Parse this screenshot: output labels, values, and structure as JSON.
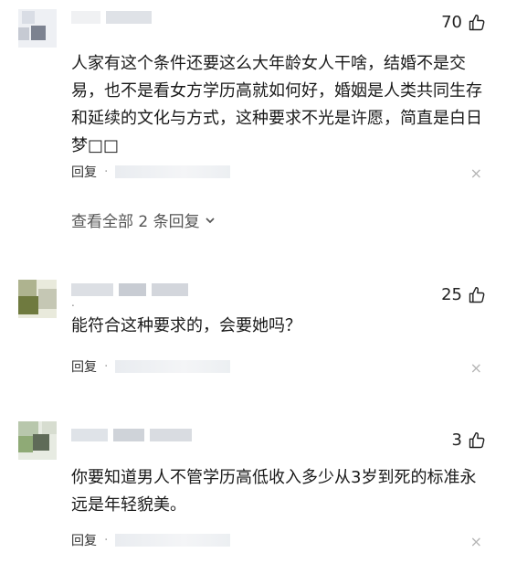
{
  "comments": [
    {
      "likes": "70",
      "text": "人家有这个条件还要这么大年龄女人干啥，结婚不是交易，也不是看女方学历高就如何好，婚姻是人类共同生存和延续的文化与方式，这种要求不光是许愿，简直是白日梦□□",
      "reply_label": "回复",
      "separator": "·",
      "close": "×",
      "view_replies": "查看全部 2 条回复"
    },
    {
      "likes": "25",
      "text": "能符合这种要求的，会要她吗？",
      "reply_label": "回复",
      "separator": "·",
      "close": "×"
    },
    {
      "likes": "3",
      "text": "你要知道男人不管学历高低收入多少从3岁到死的标准永远是年轻貌美。",
      "reply_label": "回复",
      "separator": "·",
      "close": "×"
    }
  ],
  "icons": {
    "like": "thumbs-up-icon",
    "expand": "chevron-down-icon",
    "close": "close-icon"
  },
  "colors": {
    "text": "#1a1a1a",
    "secondary": "#555555",
    "muted": "#b5b5b5"
  }
}
